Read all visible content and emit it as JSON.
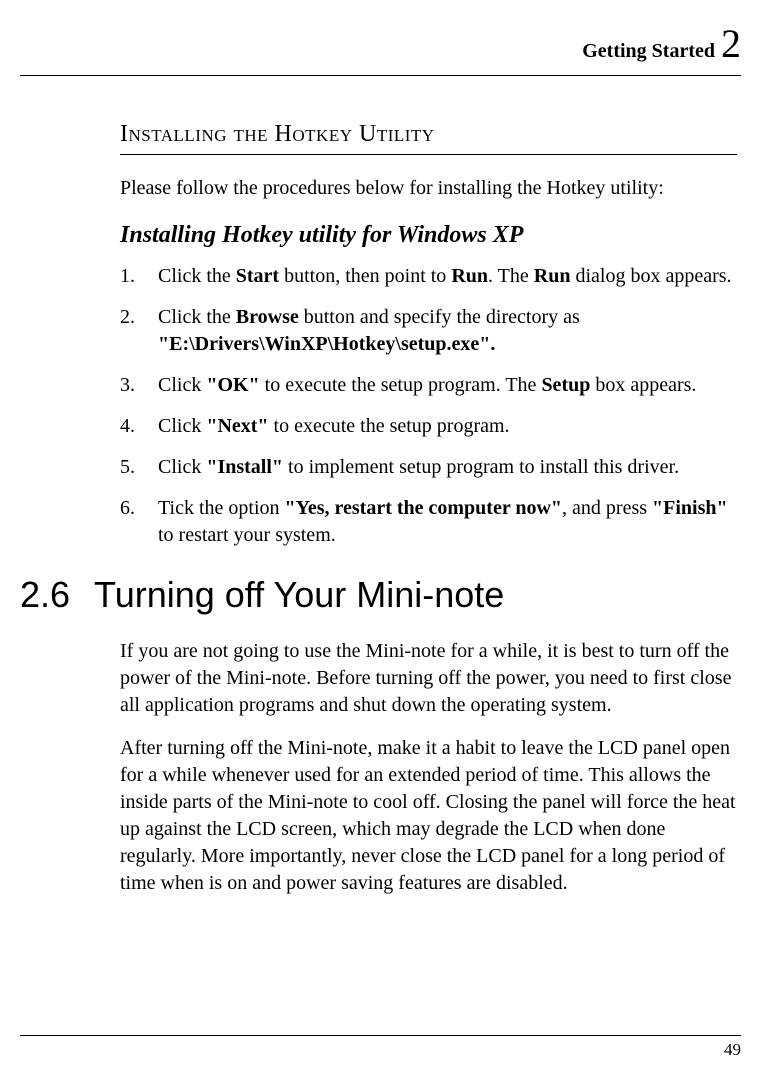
{
  "header": {
    "chapter_label": "Getting Started",
    "chapter_number": "2"
  },
  "section1": {
    "title": "Installing the Hotkey Utility",
    "intro": "Please follow the procedures below for installing the Hotkey utility:",
    "subheading": "Installing Hotkey utility for Windows XP",
    "steps": {
      "s1a": "Click the ",
      "s1b": "Start",
      "s1c": " button, then point to ",
      "s1d": "Run",
      "s1e": ". The ",
      "s1f": "Run",
      "s1g": " dialog box appears.",
      "s2a": "Click the ",
      "s2b": "Browse",
      "s2c": " button and specify the directory as ",
      "s2d": "\"E:\\Drivers\\WinXP\\Hotkey\\setup.exe\".",
      "s3a": "Click ",
      "s3b": "\"OK\"",
      "s3c": " to execute the setup program. The ",
      "s3d": "Setup",
      "s3e": " box appears.",
      "s4a": "Click ",
      "s4b": "\"Next\"",
      "s4c": " to execute the setup program.",
      "s5a": "Click ",
      "s5b": "\"Install\"",
      "s5c": " to implement setup program to install this driver.",
      "s6a": "Tick the option ",
      "s6b": "\"Yes, restart the computer now\"",
      "s6c": ", and press ",
      "s6d": "\"Finish\"",
      "s6e": " to restart your system."
    }
  },
  "section2": {
    "number": "2.6",
    "title": "Turning off Your Mini-note",
    "para1": "If you are not going to use the Mini-note for a while, it is best to turn off the power of the Mini-note. Before turning off the power, you need to first close all application programs and shut down the operating system.",
    "para2": "After turning off the Mini-note, make it a habit to leave the LCD panel open for a while whenever used for an extended period of time. This allows the inside parts of the Mini-note to cool off. Closing the panel will force the heat up against the LCD screen, which may degrade the LCD when done regularly. More importantly, never close the LCD panel for a long period of time when is on and power saving features are disabled."
  },
  "footer": {
    "page_number": "49"
  }
}
